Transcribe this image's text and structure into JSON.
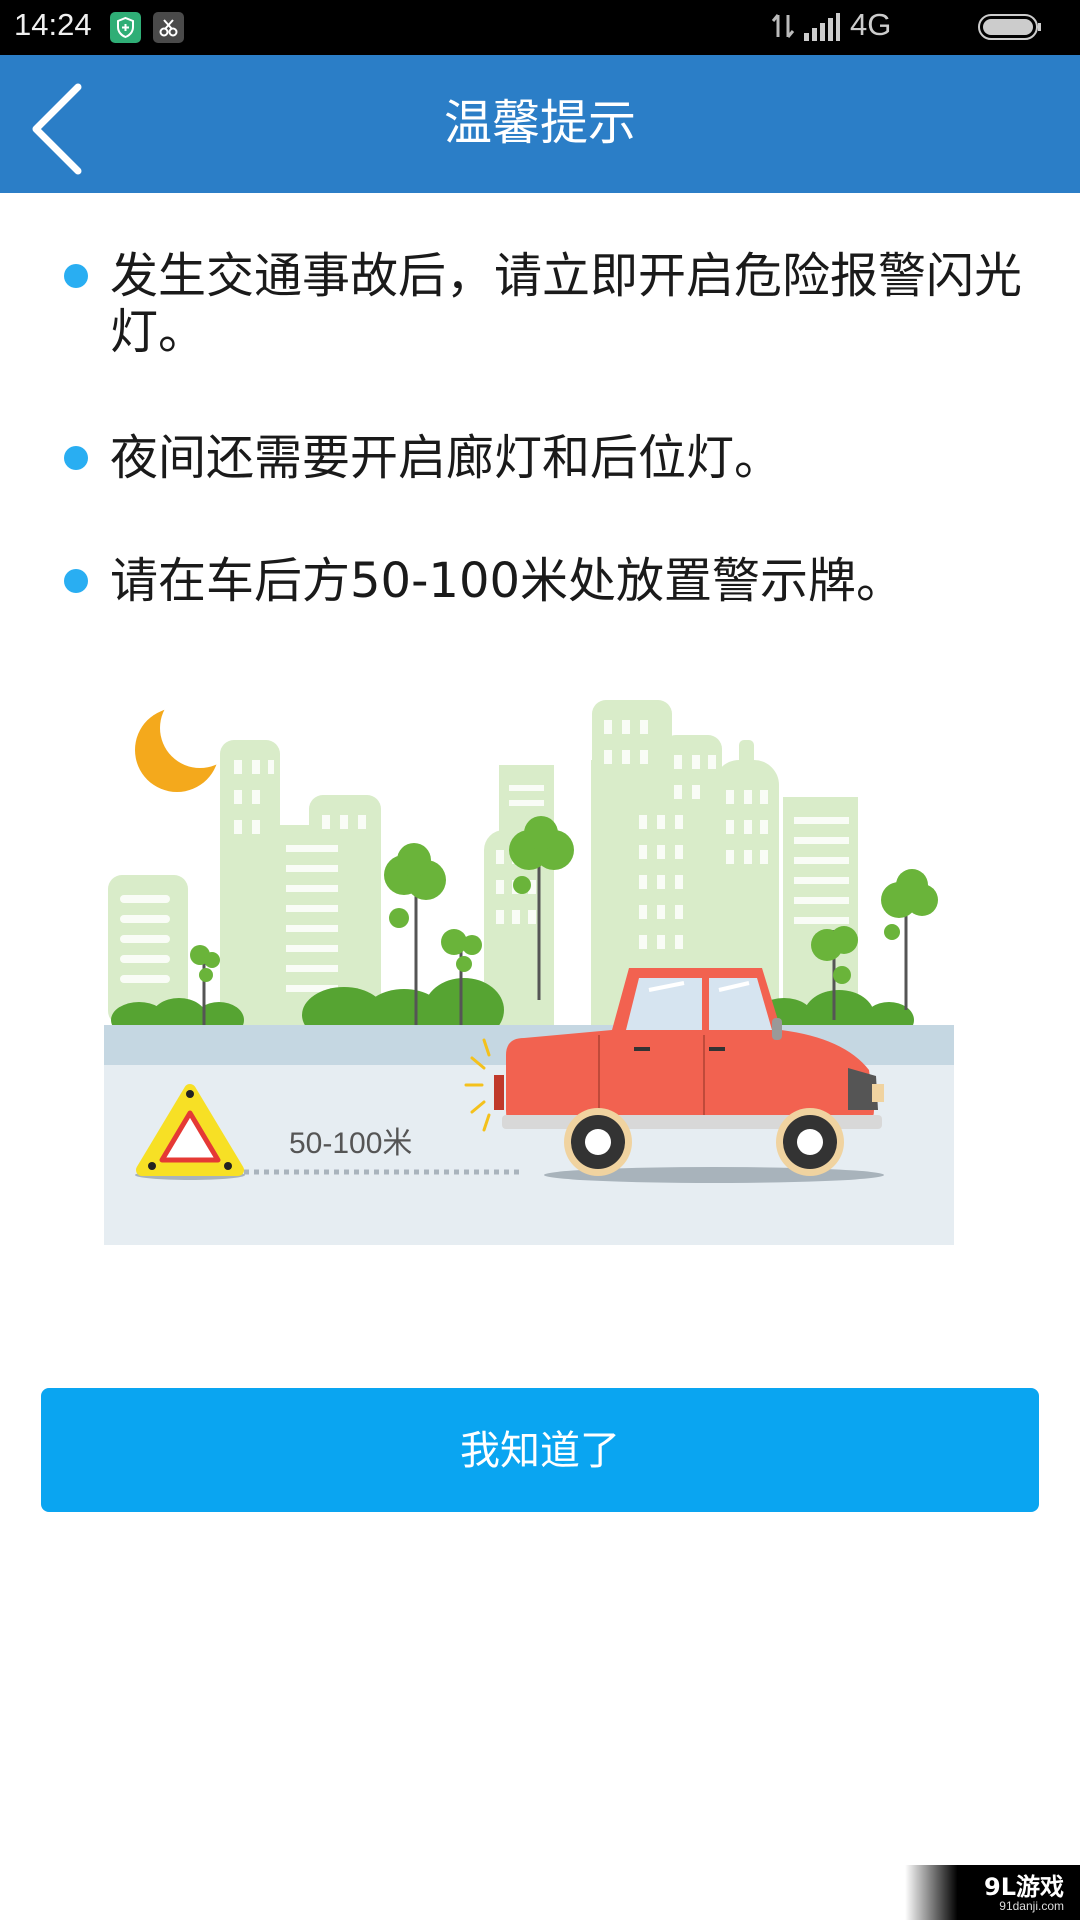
{
  "status_bar": {
    "time": "14:24",
    "network": "4G",
    "icons": [
      "shield-app-icon",
      "scissors-app-icon",
      "data-arrows-icon",
      "signal-icon",
      "battery-icon"
    ]
  },
  "header": {
    "title": "温馨提示",
    "back_icon": "chevron-left-icon"
  },
  "tips": [
    {
      "text": "发生交通事故后，请立即开启危险报警闪光灯。"
    },
    {
      "text": "夜间还需要开启廊灯和后位灯。"
    },
    {
      "text": "请在车后方50-100米处放置警示牌。"
    }
  ],
  "illustration": {
    "distance_label": "50-100米"
  },
  "confirm_button": {
    "label": "我知道了"
  },
  "watermark": {
    "brand": "9L游戏",
    "url": "91danji.com"
  },
  "colors": {
    "app_bar": "#2b7ec7",
    "bullet": "#29aef2",
    "button": "#0aa5f1",
    "car": "#f26250",
    "moon": "#f4a91c",
    "tree": "#6ab43a",
    "building": "#d9ecc9"
  }
}
